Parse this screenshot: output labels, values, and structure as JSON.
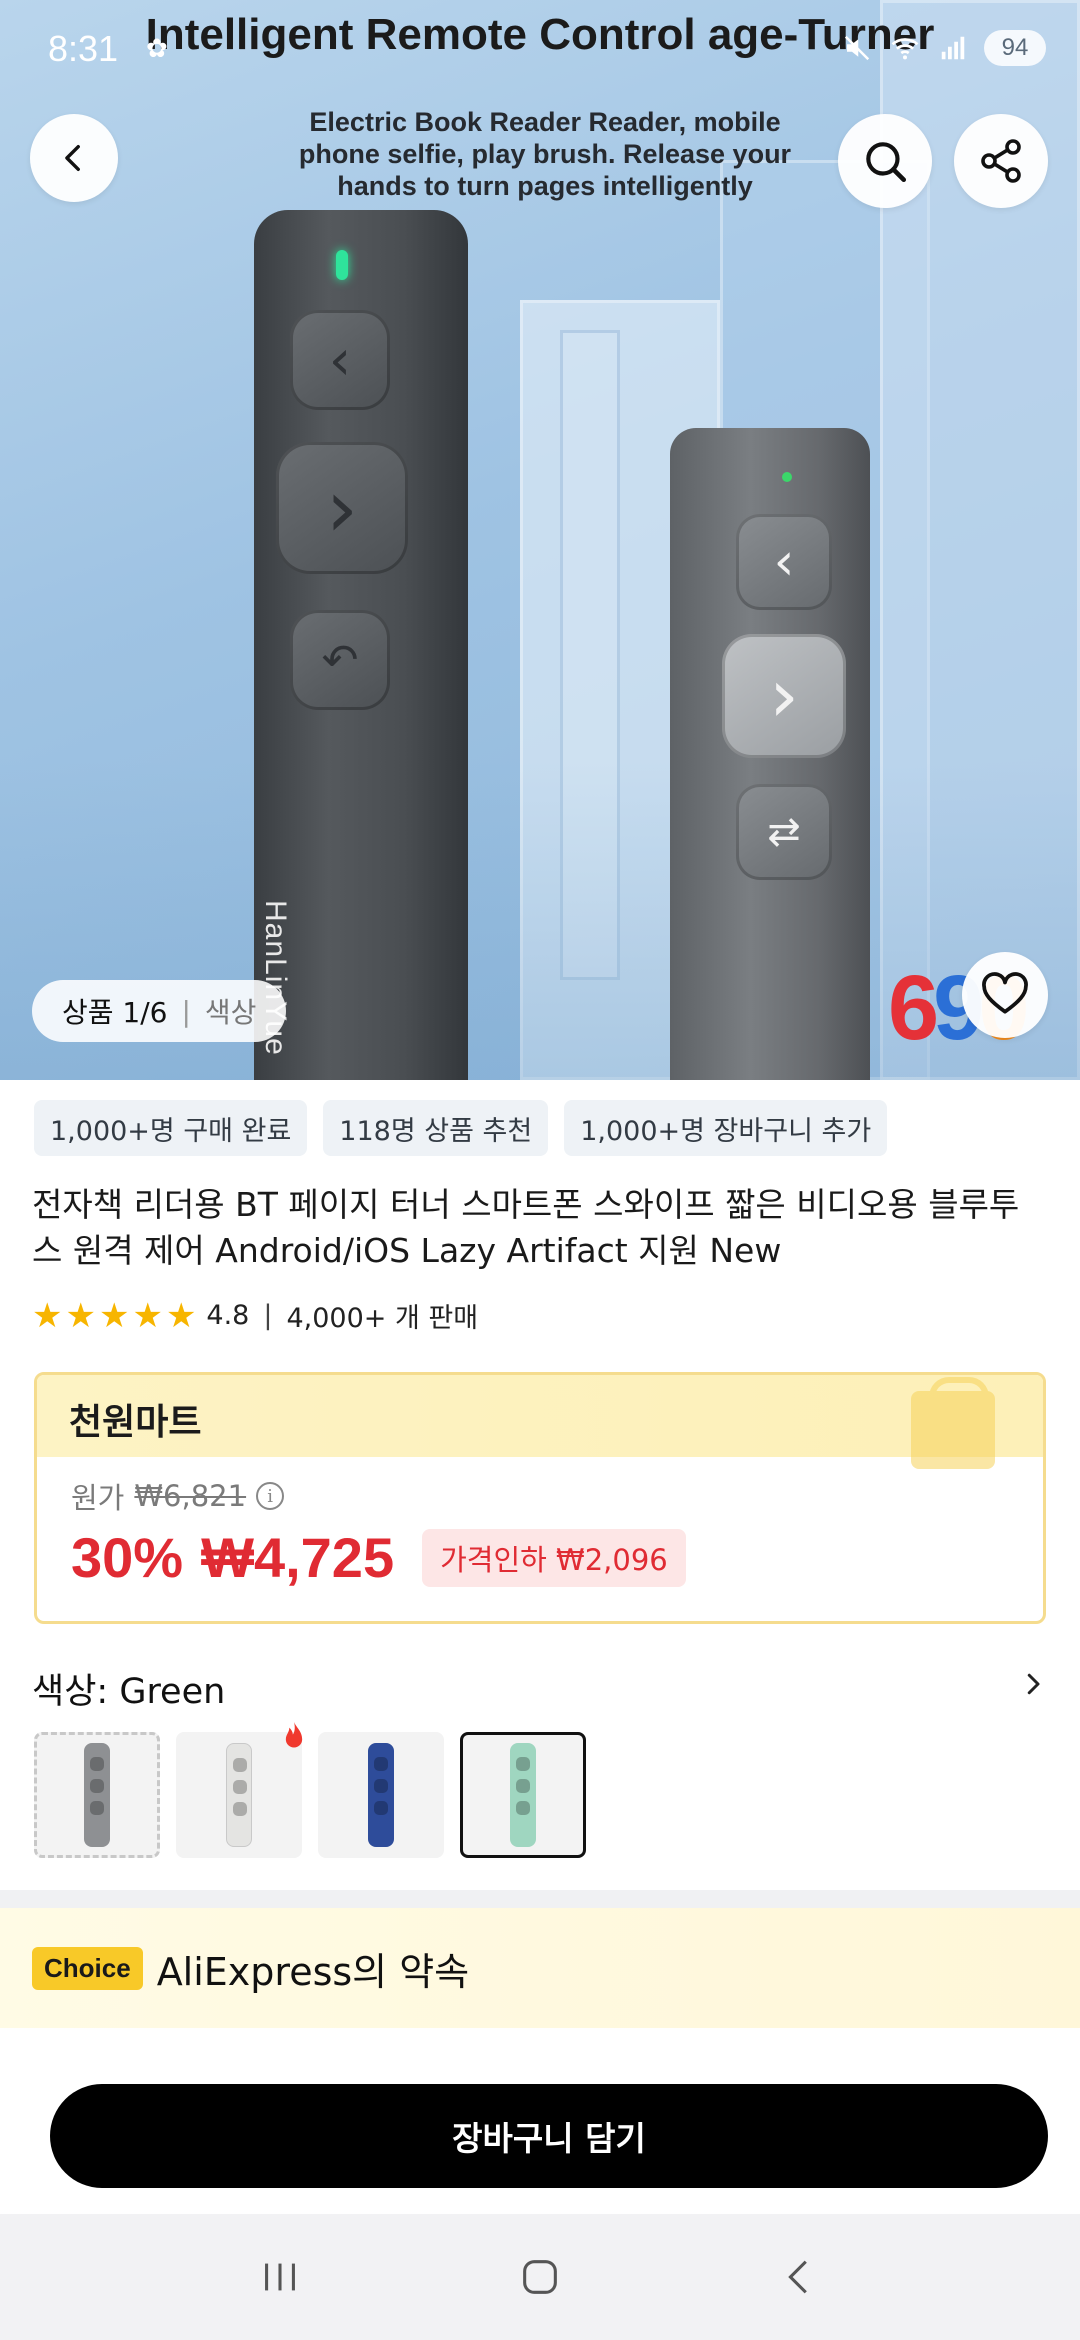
{
  "status_bar": {
    "time": "8:31",
    "battery": "94",
    "app_icon": "gallery-notification-icon",
    "icons": [
      "mute-icon",
      "wifi-icon",
      "signal-icon"
    ]
  },
  "hero": {
    "title": "Intelligent Remote Control age-Turner",
    "subtitle": "Electric Book Reader Reader, mobile phone selfie, play brush. Release your hands to turn pages intelligently",
    "remote_brand": "HanLinYue",
    "brand_mark": [
      "6",
      "9",
      "0"
    ],
    "gallery_indicator": "상품 1/6",
    "gallery_tab": "색상"
  },
  "chips": [
    "1,000+명 구매 완료",
    "118명 상품 추천",
    "1,000+명 장바구니 추가"
  ],
  "product": {
    "title": "전자책 리더용 BT 페이지 터너 스마트폰 스와이프 짧은 비디오용 블루투스 원격 제어 Android/iOS Lazy Artifact 지원 New",
    "rating": "4.8",
    "sold": "4,000+ 개 판매"
  },
  "promo": {
    "title": "천원마트",
    "original_label": "원가",
    "original_price": "₩6,821",
    "discount": "30%",
    "price": "₩4,725",
    "saving": "가격인하 ₩2,096"
  },
  "color": {
    "label": "색상: Green",
    "options": [
      {
        "name": "Gray",
        "color": "#8e9093"
      },
      {
        "name": "White",
        "color": "#e4e4e2"
      },
      {
        "name": "Blue",
        "color": "#2e4c9a"
      },
      {
        "name": "Green",
        "color": "#9fd6c0"
      }
    ],
    "selected": "Green"
  },
  "choice": {
    "badge": "Choice",
    "text": "AliExpress의 약속"
  },
  "cart_button": "장바구니 담기",
  "colors": {
    "price_red": "#e02b33",
    "promo_border": "#f5dc8e",
    "star": "#f7b500",
    "choice_badge": "#f8c928"
  }
}
